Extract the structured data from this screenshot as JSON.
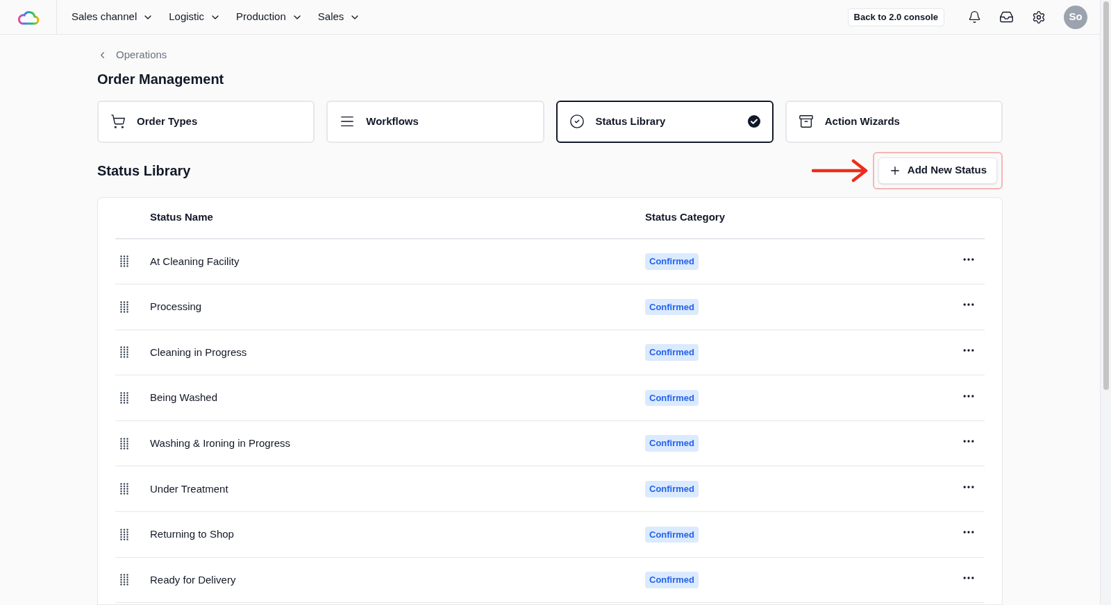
{
  "nav": {
    "items": [
      {
        "label": "Sales channel"
      },
      {
        "label": "Logistic"
      },
      {
        "label": "Production"
      },
      {
        "label": "Sales"
      }
    ],
    "console_button": "Back to 2.0 console",
    "avatar": "So"
  },
  "breadcrumb": "Operations",
  "title": "Order Management",
  "tabs": [
    {
      "label": "Order Types",
      "selected": false
    },
    {
      "label": "Workflows",
      "selected": false
    },
    {
      "label": "Status Library",
      "selected": true
    },
    {
      "label": "Action Wizards",
      "selected": false
    }
  ],
  "section_title": "Status Library",
  "add_button": "Add New Status",
  "table": {
    "columns": [
      "Status Name",
      "Status Category"
    ],
    "rows": [
      {
        "name": "At Cleaning Facility",
        "category": "Confirmed"
      },
      {
        "name": "Processing",
        "category": "Confirmed"
      },
      {
        "name": "Cleaning in Progress",
        "category": "Confirmed"
      },
      {
        "name": "Being Washed",
        "category": "Confirmed"
      },
      {
        "name": "Washing & Ironing in Progress",
        "category": "Confirmed"
      },
      {
        "name": "Under Treatment",
        "category": "Confirmed"
      },
      {
        "name": "Returning to Shop",
        "category": "Confirmed"
      },
      {
        "name": "Ready for Delivery",
        "category": "Confirmed"
      }
    ]
  }
}
